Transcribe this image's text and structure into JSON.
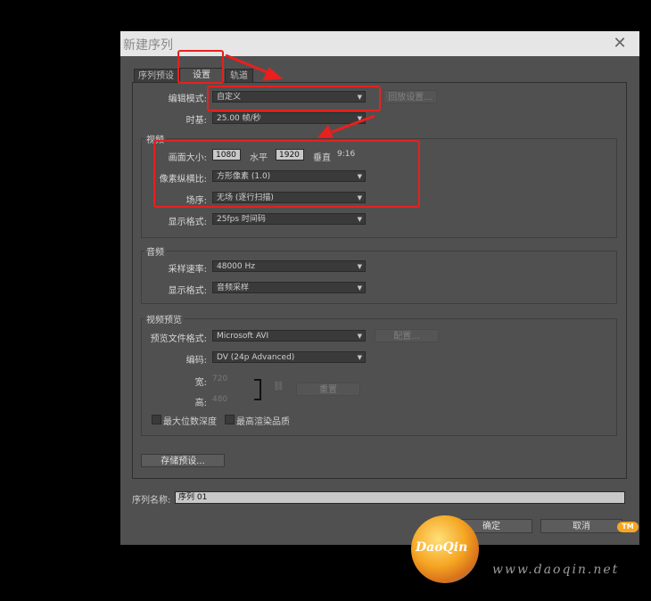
{
  "dialog": {
    "title": "新建序列",
    "close_label": "✕",
    "tabs": [
      {
        "label": "序列预设"
      },
      {
        "label": "设置"
      },
      {
        "label": "轨道"
      }
    ],
    "editing_mode": {
      "label": "编辑模式:",
      "value": "自定义",
      "playback_button": "回放设置..."
    },
    "timebase": {
      "label": "时基:",
      "value": "25.00 帧/秒"
    },
    "video": {
      "title": "视频",
      "frame_size_label": "画面大小:",
      "width_value": "1080",
      "horizontal_label": "水平",
      "height_value": "1920",
      "vertical_label": "垂直",
      "aspect": "9:16",
      "pixel_aspect_label": "像素纵横比:",
      "pixel_aspect_value": "方形像素 (1.0)",
      "fields_label": "场序:",
      "fields_value": "无场 (逐行扫描)",
      "display_format_label": "显示格式:",
      "display_format_value": "25fps 时间码"
    },
    "audio": {
      "title": "音频",
      "sample_rate_label": "采样速率:",
      "sample_rate_value": "48000 Hz",
      "display_format_label": "显示格式:",
      "display_format_value": "音频采样"
    },
    "video_preview": {
      "title": "视频预览",
      "file_format_label": "预览文件格式:",
      "file_format_value": "Microsoft AVI",
      "configure_button": "配置...",
      "codec_label": "编码:",
      "codec_value": "DV (24p Advanced)",
      "width_label": "宽:",
      "width_value": "720",
      "height_label": "高:",
      "height_value": "480",
      "reset_button": "重置",
      "max_bit_depth_label": "最大位数深度",
      "max_render_quality_label": "最高渲染品质"
    },
    "save_preset_button": "存储预设...",
    "sequence_name_label": "序列名称:",
    "sequence_name_value": "序列 01",
    "ok_button": "确定",
    "cancel_button": "取消"
  },
  "watermark": {
    "logo_text": "DaoQin",
    "site_text": "www.daoqin.net",
    "tm": "TM"
  },
  "colors": {
    "annotation_red": "#e8201e",
    "dialog_bg": "#505050",
    "titlebar_bg": "#e6e6e6"
  }
}
